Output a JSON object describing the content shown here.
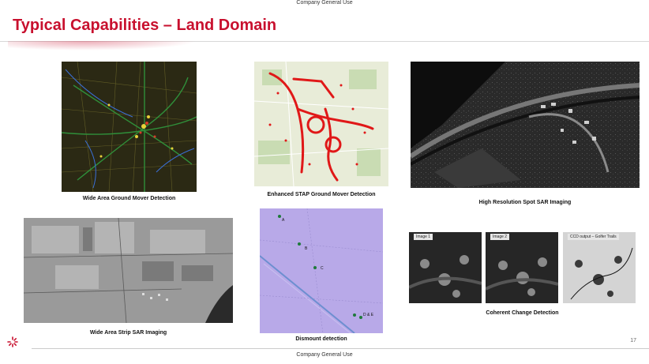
{
  "header": {
    "classification": "Company General Use"
  },
  "slide": {
    "title": "Typical Capabilities – Land Domain",
    "page_number": "17"
  },
  "footer": {
    "classification": "Company General Use"
  },
  "panels": [
    {
      "caption": "Wide Area Ground Mover Detection"
    },
    {
      "caption": "Enhanced STAP Ground Mover Detection"
    },
    {
      "caption": "High Resolution Spot SAR Imaging"
    },
    {
      "caption": "Wide Area Strip SAR Imaging"
    },
    {
      "caption": "Dismount detection"
    },
    {
      "caption": "Coherent Change Detection"
    }
  ],
  "dismount_markers": [
    "A",
    "B",
    "C",
    "D & E"
  ],
  "ccd_frames": [
    "Image 1",
    "Image 2",
    "CCD output – Golfer Trails"
  ],
  "colors": {
    "brand_red": "#c8102e"
  }
}
